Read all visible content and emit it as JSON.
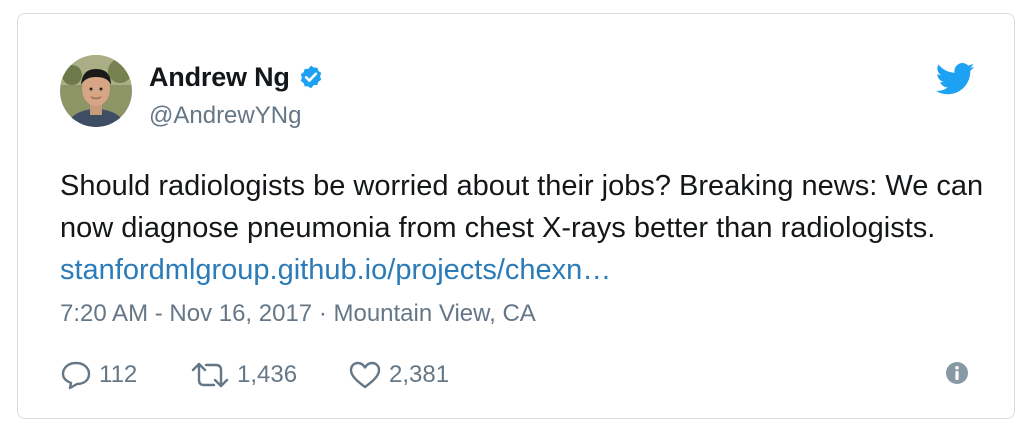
{
  "author": {
    "name": "Andrew Ng",
    "handle": "@AndrewYNg",
    "verified": true
  },
  "tweet": {
    "text": "Should radiologists be worried about their jobs? Breaking news: We can now diagnose pneumonia from chest X-rays better than radiologists.",
    "link_text": "stanfordmlgroup.github.io/projects/chexn…"
  },
  "meta": {
    "timestamp": "7:20 AM - Nov 16, 2017 · Mountain View, CA"
  },
  "actions": {
    "reply_count": "112",
    "retweet_count": "1,436",
    "like_count": "2,381"
  },
  "icons": {
    "brand": "twitter-bird-icon",
    "verified": "verified-badge-icon",
    "reply": "reply-icon",
    "retweet": "retweet-icon",
    "like": "heart-icon",
    "info": "info-icon"
  },
  "colors": {
    "brand_blue": "#1da1f2",
    "link": "#2b7bb9",
    "secondary_text": "#657786",
    "primary_text": "#14171a",
    "border": "#d9dde1"
  }
}
